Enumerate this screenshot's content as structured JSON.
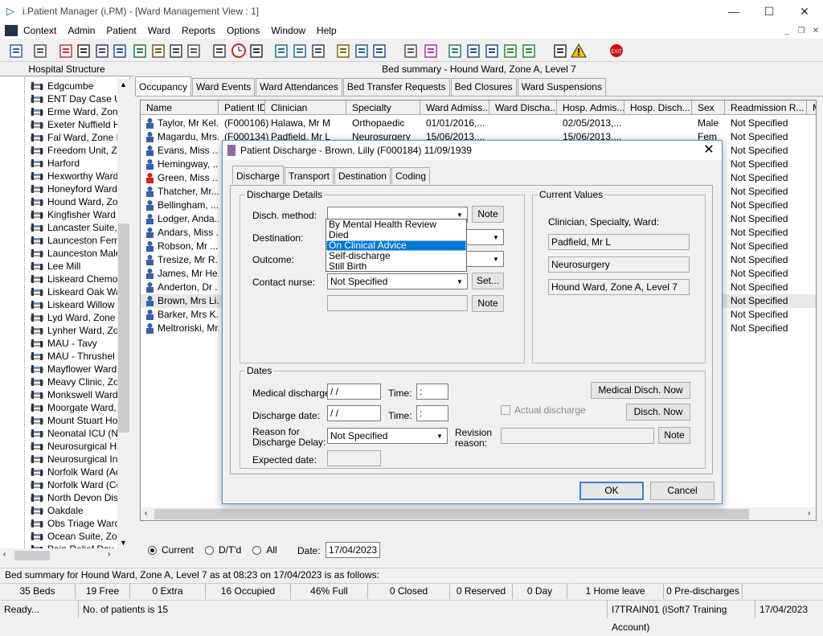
{
  "window": {
    "title": "i.Patient Manager (i.PM) - [Ward Management View : 1]"
  },
  "menu": [
    "Context",
    "Admin",
    "Patient",
    "Ward",
    "Reports",
    "Options",
    "Window",
    "Help"
  ],
  "left_panel": {
    "header": "Hospital Structure",
    "items": [
      "Edgcumbe",
      "ENT Day Case U",
      "Erme Ward, Zone",
      "Exeter Nuffield H",
      "Fal Ward, Zone E",
      "Freedom Unit, Zo",
      "Harford",
      "Hexworthy Ward,",
      "Honeyford Ward,",
      "Hound Ward, Zor",
      "Kingfisher Ward",
      "Lancaster Suite,",
      "Launceston Fema",
      "Launceston Male",
      "Lee Mill",
      "Liskeard Chemo D",
      "Liskeard Oak Wa",
      "Liskeard Willow V",
      "Lyd Ward, Zone I",
      "Lynher Ward, Zor",
      "MAU - Tavy",
      "MAU - Thrushel",
      "Mayflower Ward,",
      "Meavy Clinic, Zor",
      "Monkswell Ward,",
      "Moorgate Ward,",
      "Mount Stuart Hos",
      "Neonatal ICU (NN",
      "Neurosurgical Hig",
      "Neurosurgical Inte",
      "Norfolk Ward (Ad",
      "Norfolk Ward (Co",
      "North Devon Dist",
      "Oakdale",
      "Obs Triage Ward",
      "Ocean Suite, Zor",
      "Pain Relief Day C"
    ]
  },
  "bed_summary_title": "Bed summary - Hound Ward, Zone A, Level 7",
  "tabs": [
    "Occupancy",
    "Ward Events",
    "Ward Attendances",
    "Bed Transfer Requests",
    "Bed Closures",
    "Ward Suspensions"
  ],
  "grid": {
    "columns": [
      "Name",
      "Patient ID",
      "Clinician",
      "Specialty",
      "Ward Admiss...",
      "Ward Discha...",
      "Hosp. Admis...",
      "Hosp. Disch...",
      "Sex",
      "Readmission R...",
      "Me"
    ],
    "rows": [
      {
        "name": "Taylor, Mr Kel...",
        "id": "(F000106)",
        "clinician": "Halawa, Mr M",
        "specialty": "Orthopaedic",
        "ward_adm": "01/01/2016,...",
        "hosp_adm": "02/05/2013,...",
        "sex": "Male",
        "readm": "Not Specified"
      },
      {
        "name": "Magardu, Mrs...",
        "id": "(F000134)",
        "clinician": "Padfield, Mr L",
        "specialty": "Neurosurgery",
        "ward_adm": "15/06/2013,...",
        "hosp_adm": "15/06/2013,...",
        "sex": "Fem",
        "readm": "Not Specified"
      },
      {
        "name": "Evans, Miss ...",
        "id": "",
        "clinician": "",
        "specialty": "",
        "ward_adm": "",
        "hosp_adm": "",
        "sex": "",
        "readm": "Not Specified"
      },
      {
        "name": "Hemingway, ...",
        "id": "",
        "clinician": "",
        "specialty": "",
        "ward_adm": "",
        "hosp_adm": "",
        "sex": "",
        "readm": "Not Specified"
      },
      {
        "name": "Green, Miss ...",
        "id": "",
        "clinician": "",
        "specialty": "",
        "ward_adm": "",
        "hosp_adm": "",
        "sex": "",
        "readm": "Not Specified"
      },
      {
        "name": "Thatcher, Mr...",
        "id": "",
        "clinician": "",
        "specialty": "",
        "ward_adm": "",
        "hosp_adm": "",
        "sex": "",
        "readm": "Not Specified"
      },
      {
        "name": "Bellingham, ...",
        "id": "",
        "clinician": "",
        "specialty": "",
        "ward_adm": "",
        "hosp_adm": "",
        "sex": "",
        "readm": "Not Specified"
      },
      {
        "name": "Lodger, Anda...",
        "id": "",
        "clinician": "",
        "specialty": "",
        "ward_adm": "",
        "hosp_adm": "",
        "sex": "",
        "readm": "Not Specified"
      },
      {
        "name": "Andars, Miss ...",
        "id": "",
        "clinician": "",
        "specialty": "",
        "ward_adm": "",
        "hosp_adm": "",
        "sex": "",
        "readm": "Not Specified"
      },
      {
        "name": "Robson, Mr ...",
        "id": "",
        "clinician": "",
        "specialty": "",
        "ward_adm": "",
        "hosp_adm": "",
        "sex": "",
        "readm": "Not Specified"
      },
      {
        "name": "Tresize, Mr R...",
        "id": "",
        "clinician": "",
        "specialty": "",
        "ward_adm": "",
        "hosp_adm": "",
        "sex": "",
        "readm": "Not Specified"
      },
      {
        "name": "James, Mr He...",
        "id": "",
        "clinician": "",
        "specialty": "",
        "ward_adm": "",
        "hosp_adm": "",
        "sex": "",
        "readm": "Not Specified"
      },
      {
        "name": "Anderton, Dr ...",
        "id": "",
        "clinician": "",
        "specialty": "",
        "ward_adm": "",
        "hosp_adm": "",
        "sex": "",
        "readm": "Not Specified"
      },
      {
        "name": "Brown, Mrs Li...",
        "id": "",
        "clinician": "",
        "specialty": "",
        "ward_adm": "",
        "hosp_adm": "",
        "sex": "",
        "readm": "Not Specified"
      },
      {
        "name": "Barker, Mrs K...",
        "id": "",
        "clinician": "",
        "specialty": "",
        "ward_adm": "",
        "hosp_adm": "",
        "sex": "",
        "readm": "Not Specified"
      },
      {
        "name": "Meltroriski, Mr...",
        "id": "",
        "clinician": "",
        "specialty": "",
        "ward_adm": "",
        "hosp_adm": "",
        "sex": "",
        "readm": "Not Specified"
      }
    ]
  },
  "filter": {
    "current": "Current",
    "dtd": "D/T'd",
    "all": "All",
    "date_label": "Date:",
    "date_value": "17/04/2023"
  },
  "status_line": "Bed summary for Hound Ward, Zone A, Level 7 as at 08:23 on 17/04/2023 is as follows:",
  "stats": [
    "35 Beds",
    "19 Free",
    "0 Extra",
    "16 Occupied",
    "46% Full",
    "0 Closed",
    "0 Reserved",
    "0 Day",
    "1 Home leave",
    "0 Pre-discharges"
  ],
  "statusbar": {
    "ready": "Ready...",
    "patients": "No. of patients is 15",
    "account": "I7TRAIN01 (iSoft7 Training Account)",
    "date": "17/04/2023"
  },
  "dialog": {
    "title": "Patient Discharge - Brown, Lilly (F000184) 11/09/1939",
    "tabs": [
      "Discharge",
      "Transport",
      "Destination",
      "Coding"
    ],
    "details_group": "Discharge Details",
    "disch_method_label": "Disch. method:",
    "destination_label": "Destination:",
    "outcome_label": "Outcome:",
    "contact_nurse_label": "Contact nurse:",
    "contact_nurse_value": "Not Specified",
    "note": "Note",
    "set": "Set...",
    "dropdown": [
      "By Mental Health Review",
      "Died",
      "On Clinical Advice",
      "Self-discharge",
      "Still Birth"
    ],
    "current_group": "Current Values",
    "current_caption": "Clinician, Specialty, Ward:",
    "current_clinician": "Padfield, Mr L",
    "current_specialty": "Neurosurgery",
    "current_ward": "Hound Ward, Zone A, Level 7",
    "dates_group": "Dates",
    "medical_discharge_label": "Medical discharge:",
    "discharge_date_label": "Discharge date:",
    "date_placeholder": " /  /",
    "time_label": "Time:",
    "time_placeholder": " :",
    "medical_now": "Medical Disch. Now",
    "disch_now": "Disch. Now",
    "actual_discharge": "Actual discharge",
    "delay_label_1": "Reason for",
    "delay_label_2": "Discharge Delay:",
    "delay_value": "Not Specified",
    "revision_label_1": "Revision",
    "revision_label_2": "reason:",
    "expected_label": "Expected date:",
    "ok": "OK",
    "cancel": "Cancel"
  }
}
